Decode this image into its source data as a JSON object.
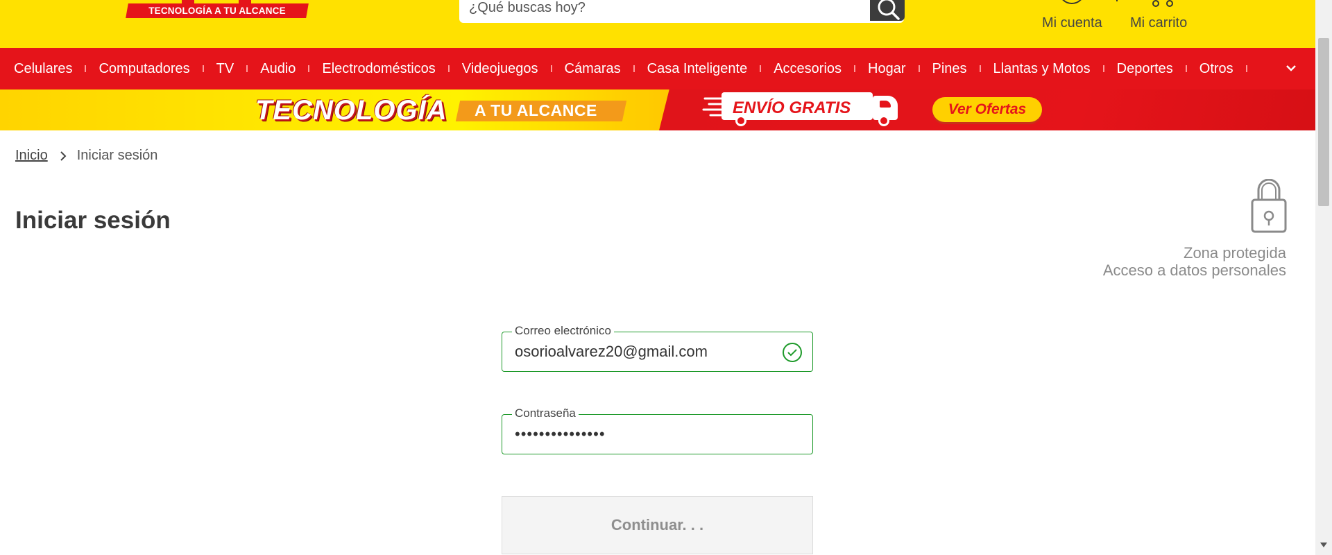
{
  "header": {
    "logo_tagline": "TECNOLOGÍA A TU ALCANCE",
    "search_placeholder": "¿Qué buscas hoy?",
    "account_label": "Mi cuenta",
    "cart_label": "Mi carrito"
  },
  "nav": {
    "items": [
      "Celulares",
      "Computadores",
      "TV",
      "Audio",
      "Electrodomésticos",
      "Videojuegos",
      "Cámaras",
      "Casa Inteligente",
      "Accesorios",
      "Hogar",
      "Pines",
      "Llantas y Motos",
      "Deportes",
      "Otros"
    ]
  },
  "banner": {
    "headline": "TECNOLOGÍA",
    "subheadline": "A TU ALCANCE",
    "shipping": "ENVÍO GRATIS",
    "offers_button": "Ver Ofertas"
  },
  "breadcrumb": {
    "home": "Inicio",
    "current": "Iniciar sesión"
  },
  "page": {
    "title": "Iniciar sesión",
    "protected_zone_line1": "Zona protegida",
    "protected_zone_line2": "Acceso a datos personales"
  },
  "form": {
    "email_label": "Correo electrónico",
    "email_value": "osorioalvarez20@gmail.com",
    "password_label": "Contraseña",
    "password_value": "•••••••••••••••",
    "continue_button": "Continuar. . ."
  },
  "colors": {
    "brand_yellow": "#ffe100",
    "brand_red": "#e5141a",
    "valid_green": "#1e9a2a"
  }
}
